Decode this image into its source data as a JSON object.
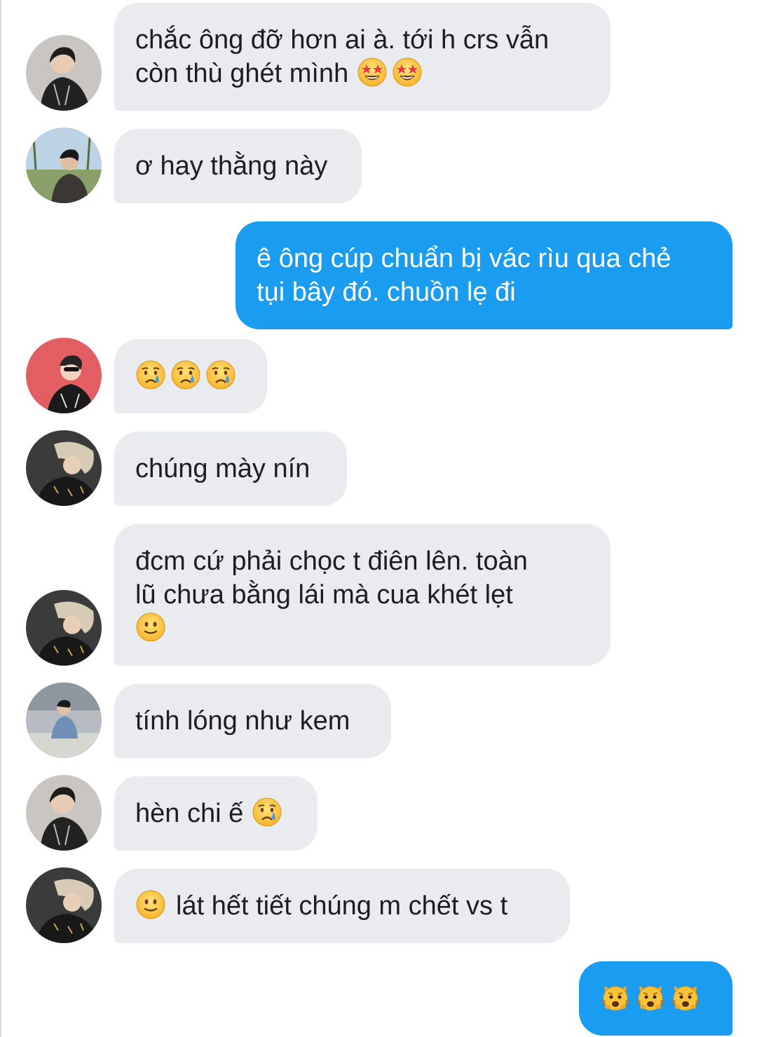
{
  "conversation": {
    "messages": [
      {
        "text": "chắc ông đỡ hơn ai à. tới h crs vẫn\ncòn thù ghét mình",
        "emojis": [
          "star-struck",
          "star-struck"
        ]
      },
      {
        "text": "ơ hay thằng này"
      },
      {
        "text": "ê ông cúp chuẩn bị vác rìu qua chẻ\ntụi bây đó. chuồn lẹ đi"
      },
      {
        "emojis": [
          "crying",
          "crying",
          "crying"
        ]
      },
      {
        "text": "chúng mày nín"
      },
      {
        "text": "đcm cứ phải chọc t điên lên. toàn\nlũ chưa bằng lái mà cua khét lẹt",
        "emojis": [
          "slight-smile"
        ]
      },
      {
        "text": "tính lóng như kem"
      },
      {
        "text": "hèn chi ế",
        "emojis": [
          "crying"
        ]
      },
      {
        "text": "lát hết tiết chúng m chết vs t",
        "emojis": [
          "slight-smile"
        ]
      },
      {
        "emojis": [
          "weary-cat",
          "weary-cat",
          "weary-cat"
        ]
      }
    ]
  },
  "colors": {
    "incoming_bubble": "#e9ebee",
    "outgoing_bubble": "#1a9cf1",
    "incoming_text": "#1c1e21",
    "outgoing_text": "#ffffff"
  }
}
